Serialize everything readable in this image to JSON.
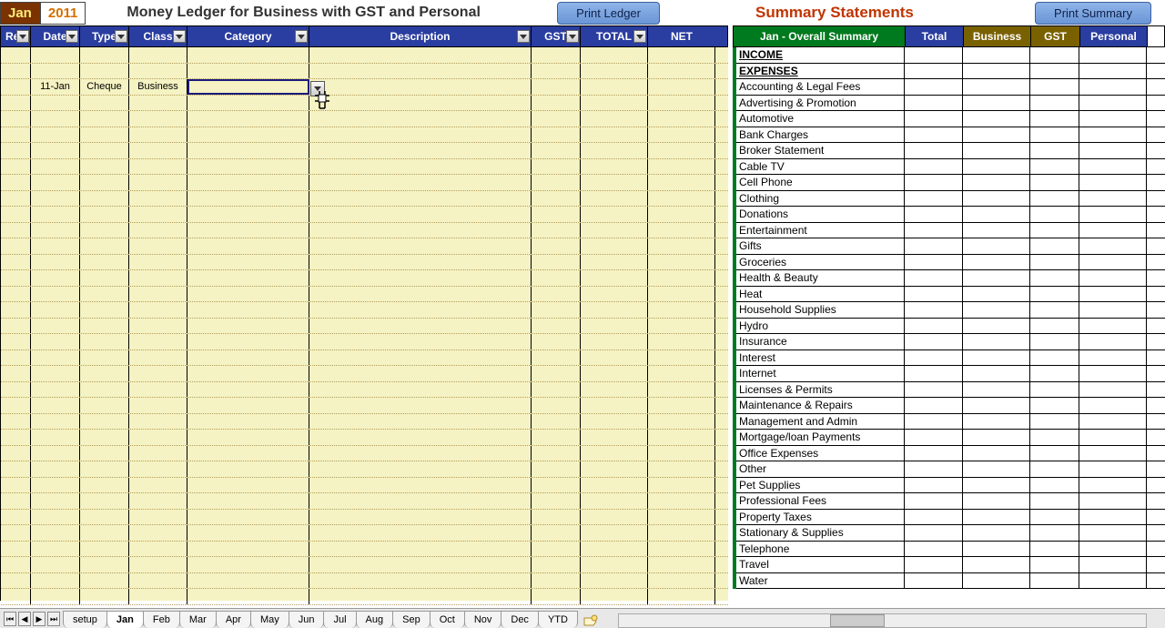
{
  "month": "Jan",
  "year": "2011",
  "ledger_title": "Money Ledger for Business with GST and Personal",
  "print_ledger": "Print Ledger",
  "summary_title": "Summary Statements",
  "print_summary": "Print Summary",
  "ledger_columns": {
    "rec": "Rec",
    "date": "Date",
    "type": "Type",
    "class": "Class",
    "category": "Category",
    "description": "Description",
    "gst": "GST",
    "total": "TOTAL",
    "net": "NET"
  },
  "ledger_entry": {
    "date": "11-Jan",
    "type": "Cheque",
    "class": "Business",
    "category": "",
    "description": "",
    "gst": "",
    "total": "",
    "net": ""
  },
  "summary_header": "Jan - Overall Summary",
  "summary_cols": {
    "total": "Total",
    "business": "Business",
    "gst": "GST",
    "personal": "Personal"
  },
  "summary_sections": {
    "income": "INCOME",
    "expenses": "EXPENSES"
  },
  "expense_categories": [
    "Accounting & Legal Fees",
    "Advertising & Promotion",
    "Automotive",
    "Bank Charges",
    "Broker Statement",
    "Cable TV",
    "Cell Phone",
    "Clothing",
    "Donations",
    "Entertainment",
    "Gifts",
    "Groceries",
    "Health & Beauty",
    "Heat",
    "Household Supplies",
    "Hydro",
    "Insurance",
    "Interest",
    "Internet",
    "Licenses & Permits",
    "Maintenance & Repairs",
    "Management and Admin",
    "Mortgage/loan Payments",
    "Office Expenses",
    "Other",
    "Pet Supplies",
    "Professional Fees",
    "Property Taxes",
    "Stationary & Supplies",
    "Telephone",
    "Travel",
    "Water"
  ],
  "tabs": [
    "setup",
    "Jan",
    "Feb",
    "Mar",
    "Apr",
    "May",
    "Jun",
    "Jul",
    "Aug",
    "Sep",
    "Oct",
    "Nov",
    "Dec",
    "YTD"
  ],
  "active_tab": "Jan"
}
